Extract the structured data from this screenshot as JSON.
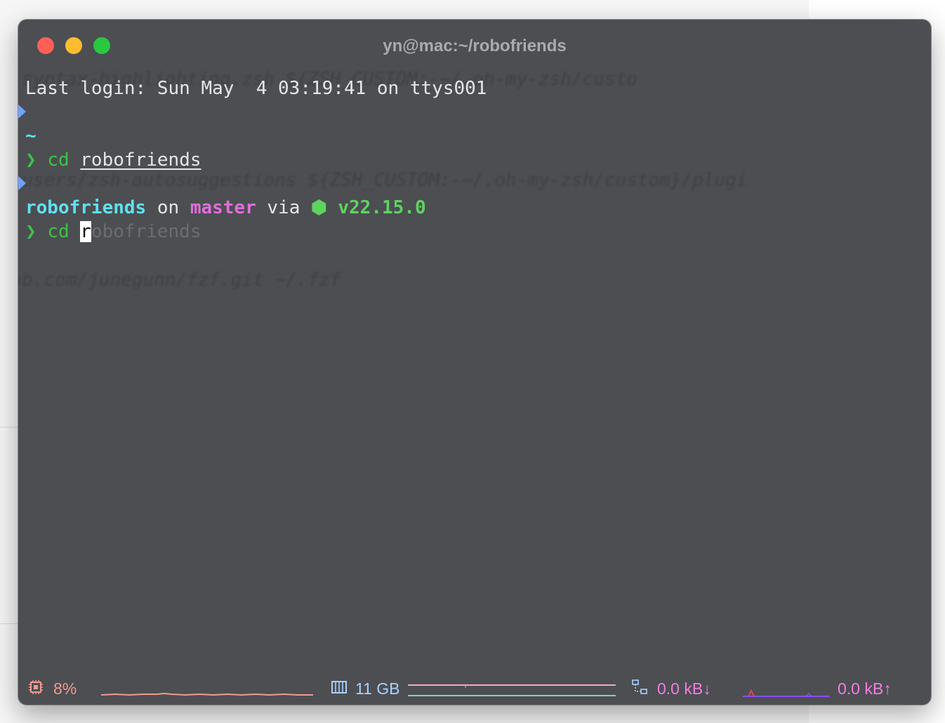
{
  "window": {
    "title": "yn@mac:~/robofriends"
  },
  "ghost_text": {
    "line1": "h-syntax-highlighting.zsh ${ZSH_CUSTOM:-~/.oh-my-zsh/custo",
    "line2": "h-users/zsh-autosuggestions ${ZSH_CUSTOM:-~/.oh-my-zsh/custom}/plugi",
    "line3": "hub.com/junegunn/fzf.git ~/.fzf"
  },
  "terminal": {
    "last_login": "Last login: Sun May  4 03:19:41 on ttys001",
    "dir_home": "~",
    "prompt_char": "❯",
    "cmd1": "cd",
    "cmd1_arg": "robofriends",
    "prompt_dir": "robofriends",
    "on_text": "on",
    "branch_icon": "",
    "branch": "master",
    "via_text": "via",
    "node_icon": "⬢",
    "node_version": "v22.15.0",
    "cmd2": "cd",
    "cmd2_typed": "r",
    "cmd2_suggestion": "obofriends"
  },
  "statusbar": {
    "cpu_icon": "cpu-icon",
    "cpu": "8%",
    "mem_icon": "memory-icon",
    "mem": "11 GB",
    "net_icon": "network-icon",
    "net_down": "0.0 kB↓",
    "net_up": "0.0 kB↑",
    "colors": {
      "cpu": "#f29a8e",
      "mem": "#a9d1ff",
      "net_down": "#f07fe0",
      "net_up": "#f07fe0"
    }
  }
}
